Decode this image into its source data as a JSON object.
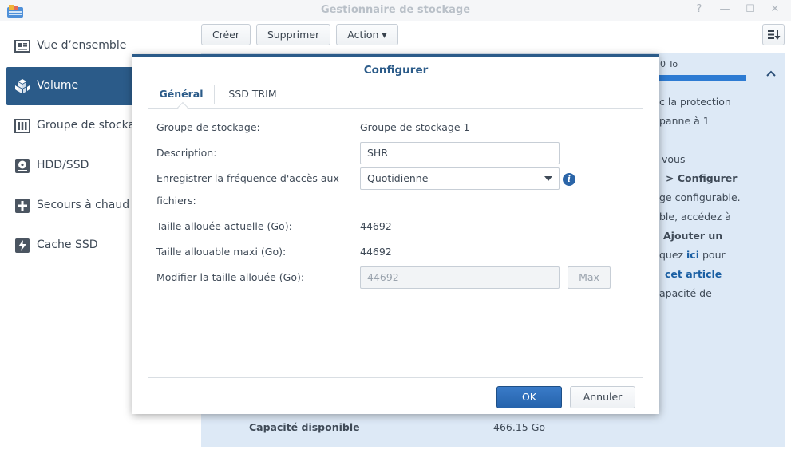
{
  "window": {
    "title": "Gestionnaire de stockage",
    "controls": {
      "help": "?",
      "minimize": "—",
      "maximize": "☐",
      "close": "✕"
    }
  },
  "sidebar": {
    "items": [
      {
        "label": "Vue d’ensemble",
        "icon": "overview-icon",
        "active": false
      },
      {
        "label": "Volume",
        "icon": "volume-cubes-icon",
        "active": true
      },
      {
        "label": "Groupe de stockage",
        "icon": "storage-pool-icon",
        "active": false
      },
      {
        "label": "HDD/SSD",
        "icon": "hdd-icon",
        "active": false
      },
      {
        "label": "Secours à chaud",
        "icon": "hot-spare-plus-icon",
        "active": false
      },
      {
        "label": "Cache SSD",
        "icon": "ssd-cache-bolt-icon",
        "active": false
      }
    ]
  },
  "toolbar": {
    "create_label": "Créer",
    "delete_label": "Supprimer",
    "action_label": "Action ▾",
    "sort_icon": "sort-icon"
  },
  "background": {
    "capacity_partial": "0 To",
    "info_lines": [
      "c la protection",
      "panne à 1",
      "vous",
      "> Configurer",
      "ge configurable.",
      "ble, accédez à",
      "Ajouter un",
      "quez",
      "ici",
      "pour",
      "cet article",
      "apacité de"
    ],
    "available_label": "Capacité disponible",
    "available_value": "466.15 Go"
  },
  "dialog": {
    "title": "Configurer",
    "tabs": [
      "Général",
      "SSD TRIM"
    ],
    "active_tab": "Général",
    "fields": {
      "storage_group_label": "Groupe de stockage:",
      "storage_group_value": "Groupe de stockage 1",
      "description_label": "Description:",
      "description_value": "SHR",
      "access_freq_label_line1": "Enregistrer la fréquence d'accès aux",
      "access_freq_label_line2": "fichiers:",
      "access_freq_value": "Quotidienne",
      "current_size_label": "Taille allouée actuelle (Go):",
      "current_size_value": "44692",
      "max_size_label": "Taille allouable maxi (Go):",
      "max_size_value": "44692",
      "modify_size_label": "Modifier la taille allouée (Go):",
      "modify_size_placeholder": "44692",
      "max_button": "Max"
    },
    "ok_label": "OK",
    "cancel_label": "Annuler"
  },
  "colors": {
    "accent": "#2b5b89",
    "primary_button": "#2d6fb8",
    "panel_bg": "#dde9f6",
    "link": "#1a5fa3"
  }
}
